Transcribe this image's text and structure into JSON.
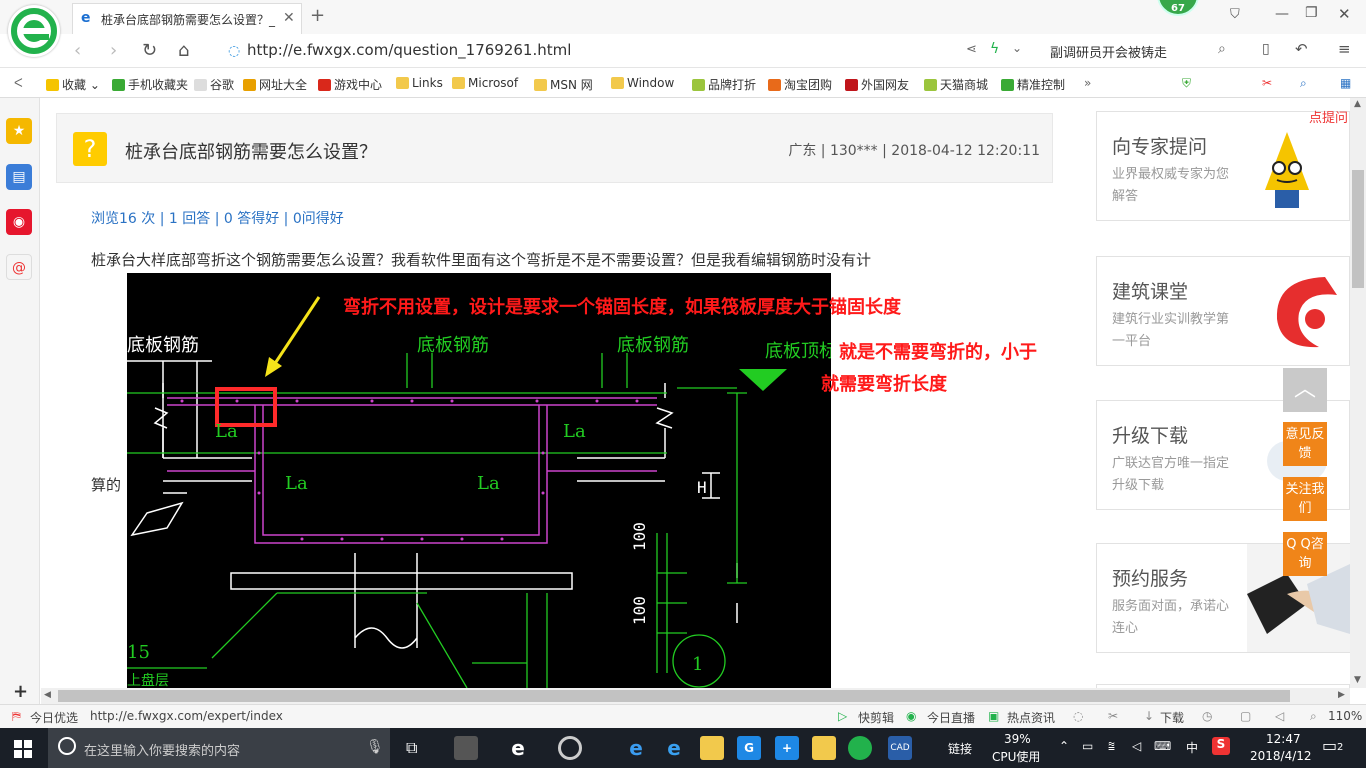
{
  "browser": {
    "tab_title": "桩承台底部钢筋需要怎么设置？_",
    "badge": "67",
    "url": "http://e.fwxgx.com/question_1769261.html",
    "search_text": "副调研员开会被铸走"
  },
  "bookmarks": [
    "收藏",
    "手机收藏夹",
    "谷歌",
    "网址大全",
    "游戏中心",
    "Links",
    "Microsof",
    "MSN 网",
    "Window",
    "品牌打折",
    "淘宝团购",
    "外国网友",
    "天猫商城",
    "精准控制"
  ],
  "question": {
    "title": "桩承台底部钢筋需要怎么设置？",
    "meta": "广东 | 130*** | 2018-04-12 12:20:11",
    "stats": "浏览16 次 | 1 回答 | 0 答得好 | 0问得好",
    "body_line1": "桩承台大样底部弯折这个钢筋需要怎么设置？我看软件里面有这个弯折是不是不需要设置？但是我看编辑钢筋时没有计",
    "body_line2": "算的"
  },
  "drawing": {
    "labels": [
      "底板钢筋",
      "底板钢筋",
      "底板钢筋",
      "底板顶标高",
      "La",
      "La",
      "La",
      "La",
      "H",
      "100",
      "100",
      "15",
      "1",
      "上盘层"
    ],
    "annotation1": "弯折不用设置，设计是要求一个锚固长度，如果筏板厚度大于锚固长度",
    "annotation2": "就是不需要弯折的，小于",
    "annotation3": "就需要弯折长度"
  },
  "ads": [
    {
      "title": "向专家提问",
      "sub": "业界最权威专家为您解答",
      "tag": "点提问"
    },
    {
      "title": "建筑课堂",
      "sub": "建筑行业实训教学第一平台"
    },
    {
      "title": "升级下载",
      "sub": "广联达官方唯一指定升级下载"
    },
    {
      "title": "预约服务",
      "sub": "服务面对面，承诺心连心"
    }
  ],
  "floating": [
    "意见反馈",
    "关注我们",
    "Q Q咨询"
  ],
  "status": {
    "left": "今日优选",
    "url": "http://e.fwxgx.com/expert/index",
    "items": [
      "快剪辑",
      "今日直播",
      "热点资讯",
      "下载"
    ],
    "zoom": "110%"
  },
  "taskbar": {
    "search_placeholder": "在这里输入你要搜索的内容",
    "link": "链接",
    "cpu": "39%",
    "cpu_label": "CPU使用",
    "ime": "中",
    "time": "12:47",
    "date": "2018/4/12",
    "notif": "2"
  },
  "colors": {
    "accent": "#22b24c",
    "orange": "#f08519",
    "link": "#2a72c4",
    "annotation": "#ff1a1a"
  }
}
